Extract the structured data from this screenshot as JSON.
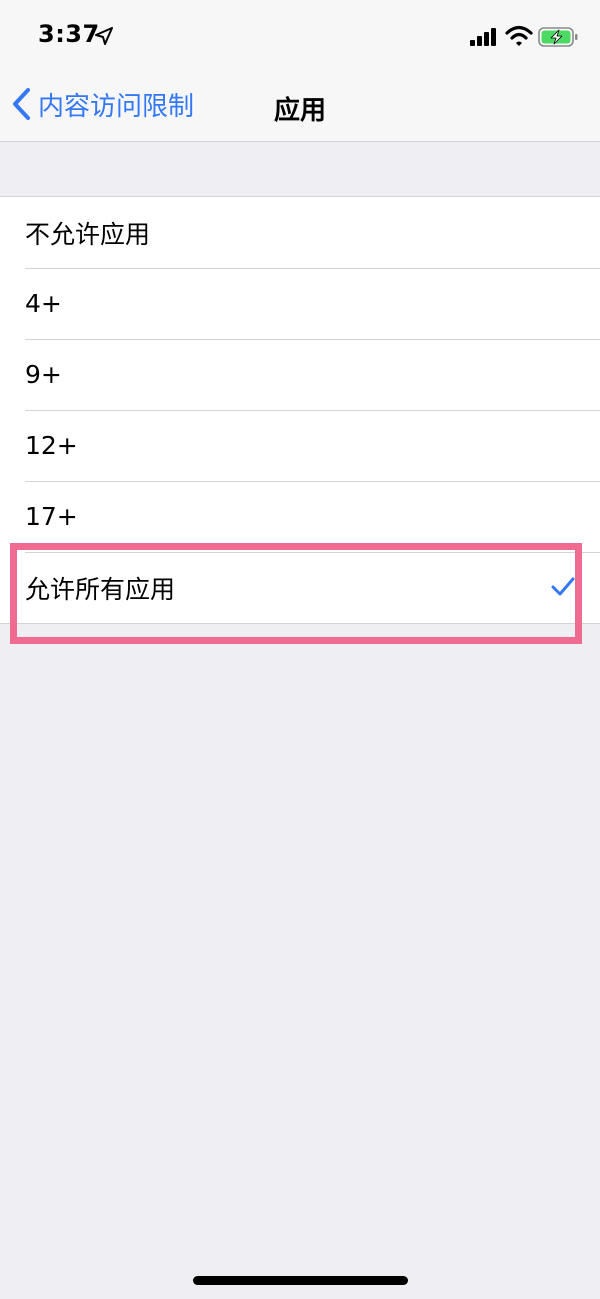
{
  "status_bar": {
    "time": "3:37",
    "icons": [
      "location-arrow-icon",
      "cellular-signal-icon",
      "wifi-icon",
      "battery-charging-icon"
    ]
  },
  "nav": {
    "back_label": "内容访问限制",
    "title": "应用"
  },
  "options": [
    {
      "label": "不允许应用",
      "selected": false
    },
    {
      "label": "4+",
      "selected": false
    },
    {
      "label": "9+",
      "selected": false
    },
    {
      "label": "12+",
      "selected": false
    },
    {
      "label": "17+",
      "selected": false
    },
    {
      "label": "允许所有应用",
      "selected": true
    }
  ],
  "colors": {
    "accent": "#3478f6",
    "highlight": "#f06b92",
    "background": "#efeef3",
    "battery_charge": "#4cd964"
  }
}
